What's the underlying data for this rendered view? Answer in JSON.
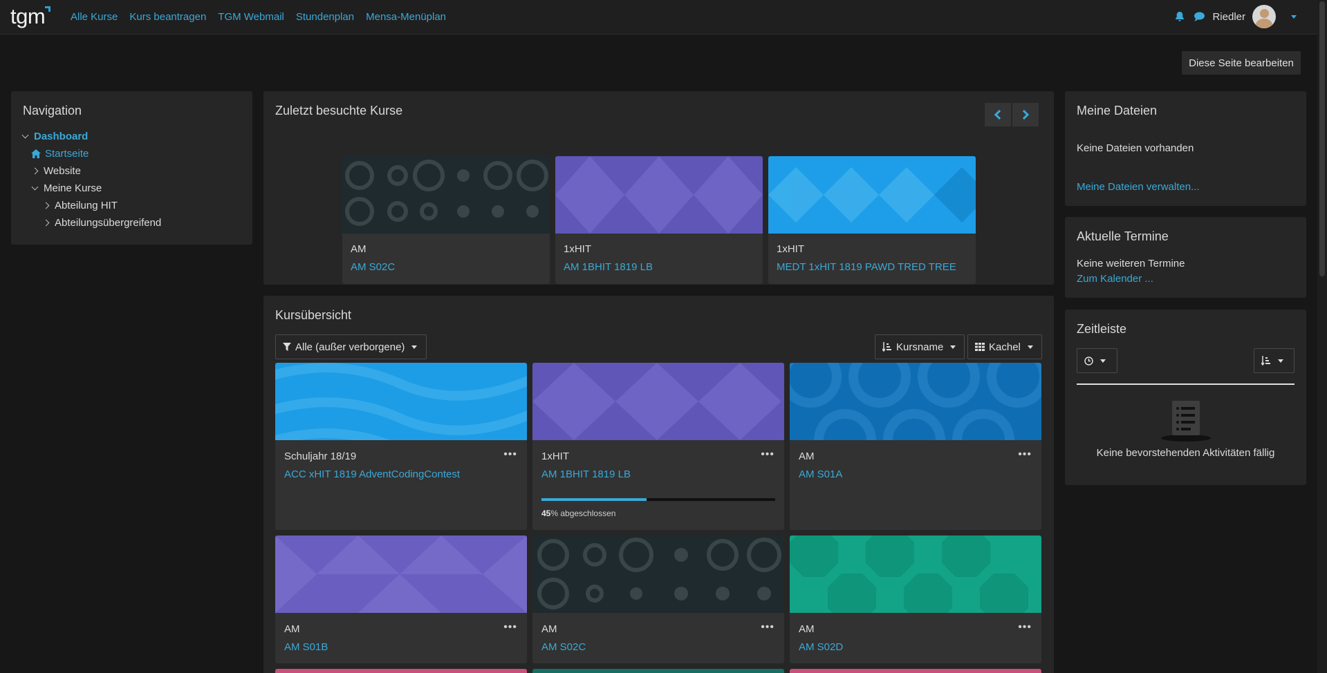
{
  "topbar": {
    "logo": "tgm",
    "nav": [
      "Alle Kurse",
      "Kurs beantragen",
      "TGM Webmail",
      "Stundenplan",
      "Mensa-Menüplan"
    ],
    "user": "Riedler",
    "icons": [
      "bell-icon",
      "chat-icon"
    ]
  },
  "page": {
    "edit_button": "Diese Seite bearbeiten"
  },
  "navigation": {
    "title": "Navigation",
    "items": [
      {
        "label": "Dashboard",
        "level": 0,
        "expanded": true,
        "active": true
      },
      {
        "label": "Startseite",
        "level": 1,
        "icon": "home-icon"
      },
      {
        "label": "Website",
        "level": 1,
        "expanded": false
      },
      {
        "label": "Meine Kurse",
        "level": 1,
        "expanded": true
      },
      {
        "label": "Abteilung HIT",
        "level": 2,
        "expanded": false
      },
      {
        "label": "Abteilungsübergreifend",
        "level": 2,
        "expanded": false
      }
    ]
  },
  "recent": {
    "title": "Zuletzt besuchte Kurse",
    "items": [
      {
        "category": "AM",
        "name": "AM S02C",
        "color": "#1e2a2e"
      },
      {
        "category": "1xHIT",
        "name": "AM 1BHIT 1819 LB",
        "color": "#5f56b8"
      },
      {
        "category": "1xHIT",
        "name": "MEDT 1xHIT 1819 PAWD TRED TREE",
        "color": "#1e9ee8"
      }
    ]
  },
  "overview": {
    "title": "Kursübersicht",
    "filter": "Alle (außer verborgene)",
    "sort": "Kursname",
    "view": "Kachel",
    "courses": [
      {
        "category": "Schuljahr 18/19",
        "name": "ACC xHIT 1819 AdventCodingContest",
        "color": "#1d9de6"
      },
      {
        "category": "1xHIT",
        "name": "AM 1BHIT 1819 LB",
        "color": "#5f56b8",
        "progress": 45,
        "progress_label": "45",
        "progress_suffix": "% abgeschlossen"
      },
      {
        "category": "AM",
        "name": "AM S01A",
        "color": "#0f6db3"
      },
      {
        "category": "AM",
        "name": "AM S01B",
        "color": "#6a5fc0"
      },
      {
        "category": "AM",
        "name": "AM S02C",
        "color": "#1e2a2e"
      },
      {
        "category": "AM",
        "name": "AM S02D",
        "color": "#13a386"
      }
    ]
  },
  "files": {
    "title": "Meine Dateien",
    "empty": "Keine Dateien vorhanden",
    "manage": "Meine Dateien verwalten..."
  },
  "events": {
    "title": "Aktuelle Termine",
    "empty": "Keine weiteren Termine",
    "calendar": "Zum Kalender ..."
  },
  "timeline": {
    "title": "Zeitleiste",
    "empty": "Keine bevorstehenden Aktivitäten fällig"
  }
}
